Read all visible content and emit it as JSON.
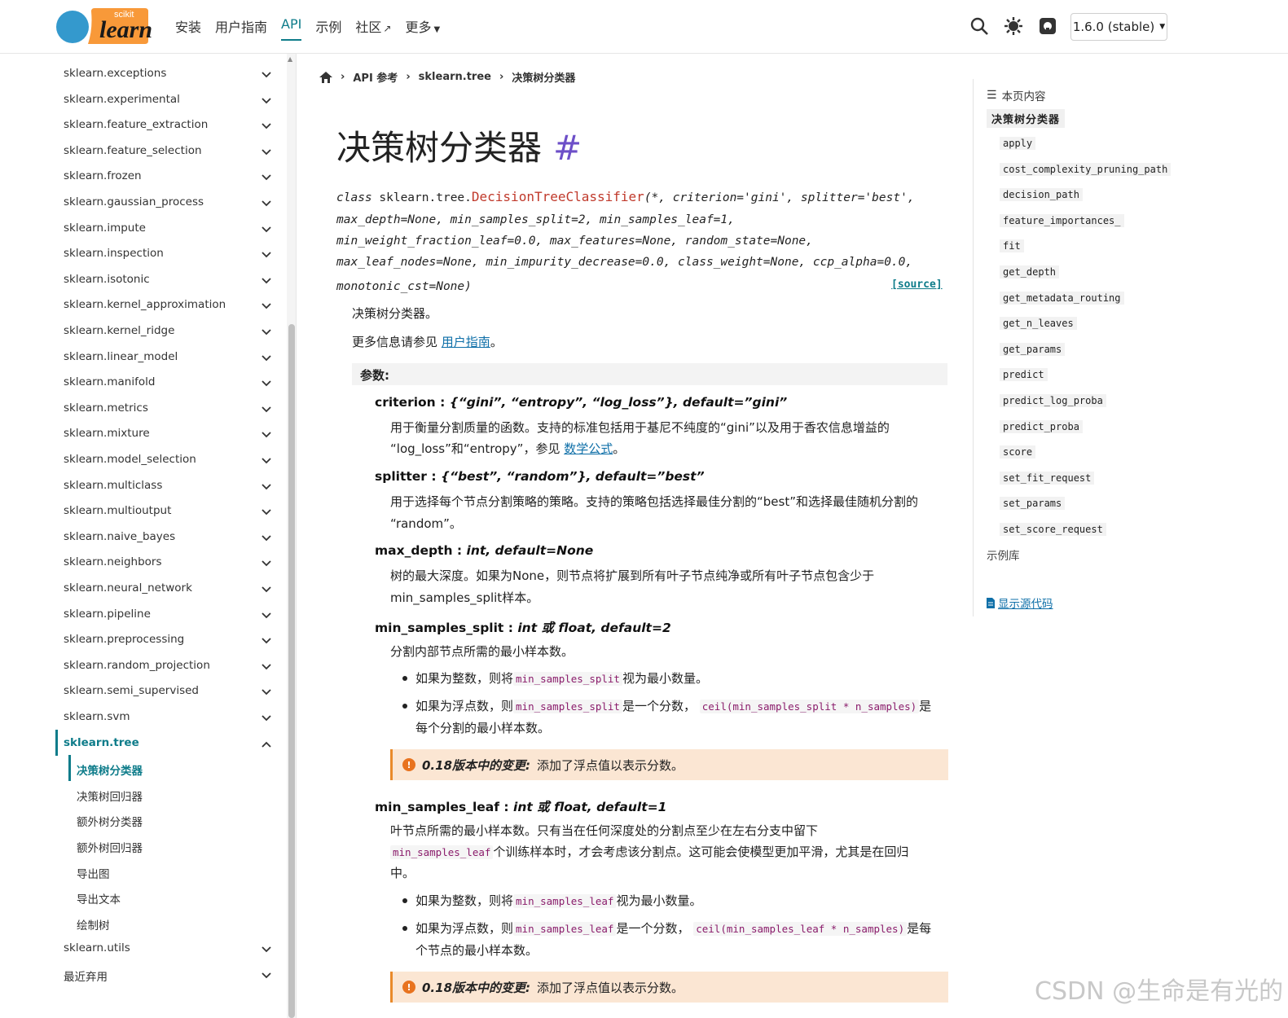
{
  "header": {
    "logo_top": "scikit",
    "logo_main": "learn",
    "nav": [
      {
        "label": "安装"
      },
      {
        "label": "用户指南"
      },
      {
        "label": "API"
      },
      {
        "label": "示例"
      },
      {
        "label": "社区"
      },
      {
        "label": "更多"
      }
    ],
    "version": "1.6.0 (stable)"
  },
  "sidebar": {
    "items": [
      "sklearn.exceptions",
      "sklearn.experimental",
      "sklearn.feature_extraction",
      "sklearn.feature_selection",
      "sklearn.frozen",
      "sklearn.gaussian_process",
      "sklearn.impute",
      "sklearn.inspection",
      "sklearn.isotonic",
      "sklearn.kernel_approximation",
      "sklearn.kernel_ridge",
      "sklearn.linear_model",
      "sklearn.manifold",
      "sklearn.metrics",
      "sklearn.mixture",
      "sklearn.model_selection",
      "sklearn.multiclass",
      "sklearn.multioutput",
      "sklearn.naive_bayes",
      "sklearn.neighbors",
      "sklearn.neural_network",
      "sklearn.pipeline",
      "sklearn.preprocessing",
      "sklearn.random_projection",
      "sklearn.semi_supervised",
      "sklearn.svm"
    ],
    "active": "sklearn.tree",
    "subitems": [
      "决策树分类器",
      "决策树回归器",
      "额外树分类器",
      "额外树回归器",
      "导出图",
      "导出文本",
      "绘制树"
    ],
    "after": [
      "sklearn.utils",
      "最近弃用"
    ]
  },
  "breadcrumb": {
    "api": "API 参考",
    "module": "sklearn.tree",
    "current": "决策树分类器"
  },
  "title": "决策树分类器",
  "title_anchor": "#",
  "signature": {
    "prefix": "class",
    "module": "sklearn.tree.",
    "name": "DecisionTreeClassifier",
    "line1_rest": "(*, criterion='gini', splitter='best',",
    "line2": "max_depth=None, min_samples_split=2, min_samples_leaf=1,",
    "line3": "min_weight_fraction_leaf=0.0, max_features=None, random_state=None,",
    "line4": "max_leaf_nodes=None, min_impurity_decrease=0.0, class_weight=None, ccp_alpha=0.0,",
    "line5": "monotonic_cst=None)",
    "source": "[source]"
  },
  "summary": "决策树分类器。",
  "more_info_prefix": "更多信息请参见",
  "more_info_link": "用户指南",
  "more_info_suffix": "。",
  "params_heading": "参数:",
  "params": {
    "criterion": {
      "name": "criterion",
      "type": "{“gini”, “entropy”, “log_loss”}, default=”gini”",
      "desc1": "用于衡量分割质量的函数。支持的标准包括用于基尼不纯度的“gini”以及用于香农信息增益的",
      "desc2": "“log_loss”和“entropy”，参见",
      "desc2_link": "数学公式",
      "desc2_end": "。"
    },
    "splitter": {
      "name": "splitter",
      "type": "{“best”, “random”}, default=”best”",
      "desc1": "用于选择每个节点分割策略的策略。支持的策略包括选择最佳分割的“best”和选择最佳随机分割的",
      "desc2": "“random”。"
    },
    "max_depth": {
      "name": "max_depth",
      "type": "int, default=None",
      "desc1": "树的最大深度。如果为None，则节点将扩展到所有叶子节点纯净或所有叶子节点包含少于",
      "desc2": "min_samples_split样本。"
    },
    "min_samples_split": {
      "name": "min_samples_split",
      "type": "int 或 float, default=2",
      "desc": "分割内部节点所需的最小样本数。",
      "b1_pre": "如果为整数，则将",
      "b1_code": "min_samples_split",
      "b1_post": "视为最小数量。",
      "b2_pre": "如果为浮点数，则",
      "b2_code": "min_samples_split",
      "b2_mid": "是一个分数，",
      "b2_code2": "ceil(min_samples_split * n_samples)",
      "b2_post": "是",
      "b2_line2": "每个分割的最小样本数。",
      "note_label": "0.18版本中的变更:",
      "note_text": "添加了浮点值以表示分数。"
    },
    "min_samples_leaf": {
      "name": "min_samples_leaf",
      "type": "int 或 float, default=1",
      "desc1": "叶节点所需的最小样本数。只有当在任何深度处的分割点至少在左右分支中留下",
      "desc2_code": "min_samples_leaf",
      "desc2": "个训练样本时，才会考虑该分割点。这可能会使模型更加平滑，尤其是在回归",
      "desc3": "中。",
      "b1_pre": "如果为整数，则将",
      "b1_code": "min_samples_leaf",
      "b1_post": "视为最小数量。",
      "b2_pre": "如果为浮点数，则",
      "b2_code": "min_samples_leaf",
      "b2_mid": "是一个分数，",
      "b2_code2": "ceil(min_samples_leaf * n_samples)",
      "b2_post": "是每",
      "b2_line2": "个节点的最小样本数。",
      "note_label": "0.18版本中的变更:",
      "note_text": "添加了浮点值以表示分数。"
    }
  },
  "toc": {
    "heading": "本页内容",
    "main": "决策树分类器",
    "items": [
      "apply",
      "cost_complexity_pruning_path",
      "decision_path",
      "feature_importances_",
      "fit",
      "get_depth",
      "get_metadata_routing",
      "get_n_leaves",
      "get_params",
      "predict",
      "predict_log_proba",
      "predict_proba",
      "score",
      "set_fit_request",
      "set_params",
      "set_score_request"
    ],
    "gallery": "示例库",
    "show_source": "显示源代码"
  },
  "watermark": "CSDN @生命是有光的"
}
